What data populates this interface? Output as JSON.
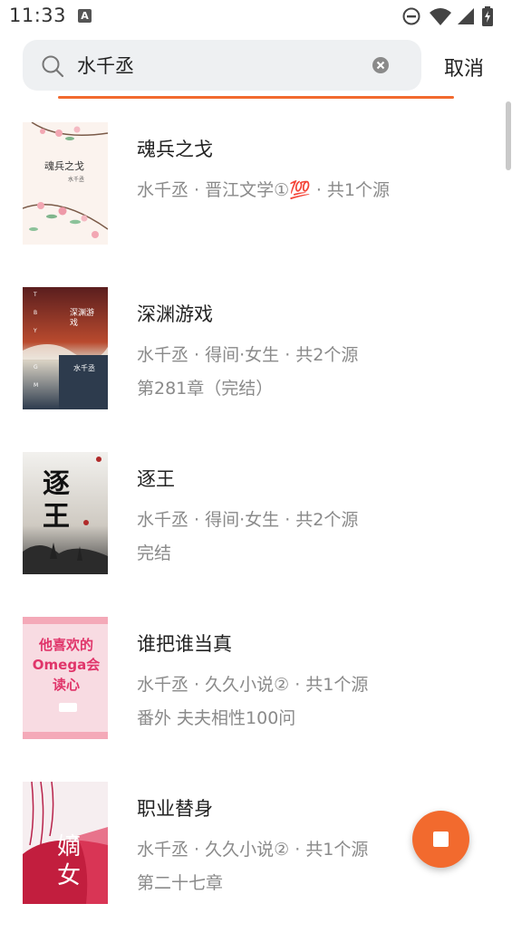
{
  "status_bar": {
    "time": "11:33",
    "notification_icon_letter": "A",
    "icons": [
      "notification-a-icon",
      "do-not-disturb-icon",
      "wifi-icon",
      "signal-icon",
      "battery-icon"
    ]
  },
  "search": {
    "query": "水千丞",
    "cancel_label": "取消",
    "accent_color": "#f26a2e"
  },
  "books": [
    {
      "title": "魂兵之戈",
      "meta": "水千丞 · 晋江文学①💯 · 共1个源",
      "latest": "",
      "cover_text": "魂兵之戈",
      "cover_author": "水千丞"
    },
    {
      "title": "深渊游戏",
      "meta": "水千丞 · 得间·女生 · 共2个源",
      "latest": "第281章（完结）",
      "cover_text": "深渊游戏",
      "cover_author": "水千丞"
    },
    {
      "title": "逐王",
      "meta": "水千丞 · 得间·女生 · 共2个源",
      "latest": "完结",
      "cover_text": "逐王",
      "cover_author": ""
    },
    {
      "title": "谁把谁当真",
      "meta": "水千丞 · 久久小说② · 共1个源",
      "latest": "番外 夫夫相性100问",
      "cover_text": "他喜欢的Omega会读心",
      "cover_author": ""
    },
    {
      "title": "职业替身",
      "meta": "水千丞 · 久久小说② · 共1个源",
      "latest": "第二十七章",
      "cover_text": "嫡女",
      "cover_author": ""
    }
  ],
  "fab": {
    "icon": "stop-icon",
    "color": "#f26a2e"
  }
}
